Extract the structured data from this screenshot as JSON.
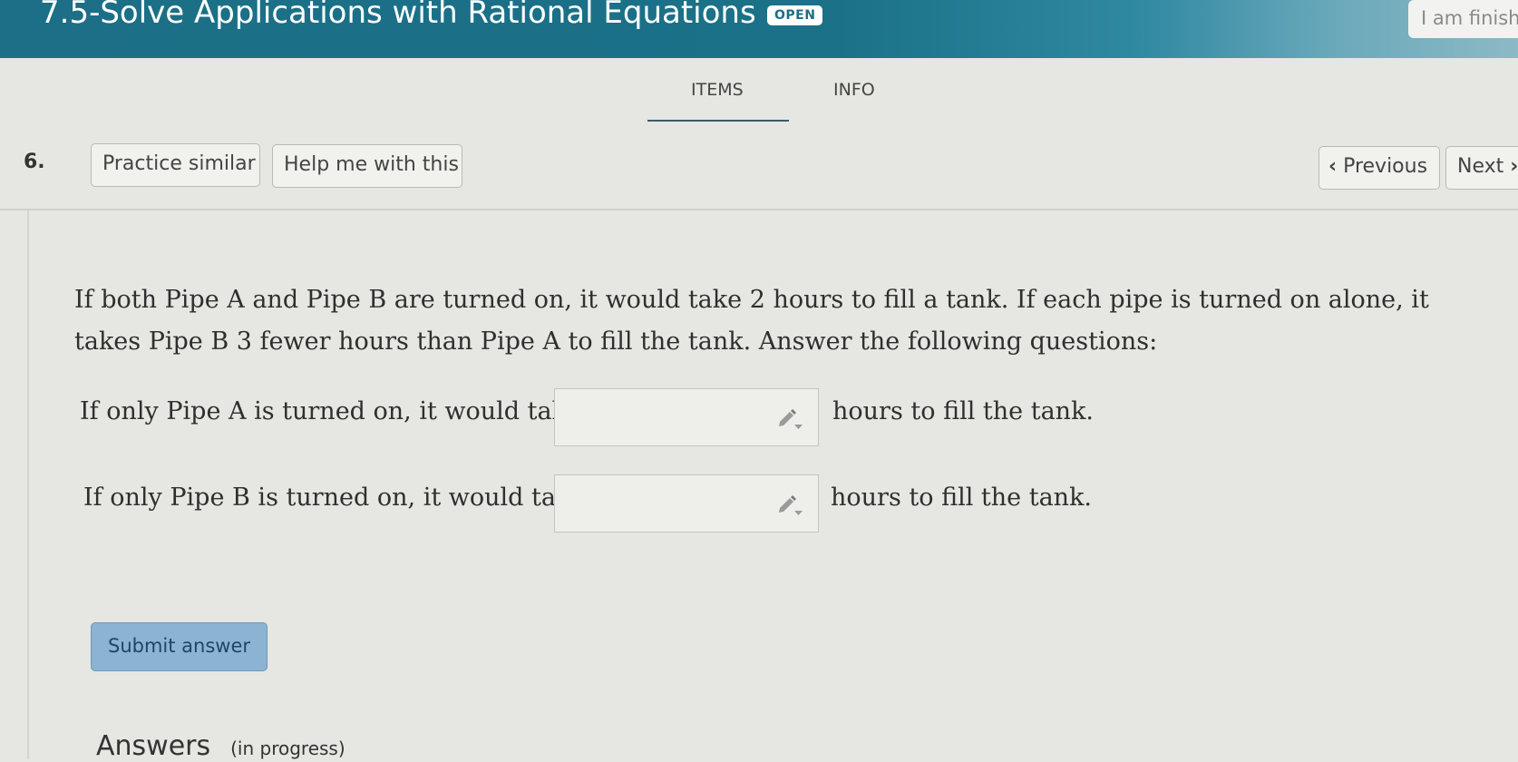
{
  "header": {
    "title": "7.5-Solve Applications with Rational Equations",
    "status_badge": "OPEN",
    "finish_button": "I am finish"
  },
  "tabs": [
    {
      "label": "ITEMS",
      "active": true
    },
    {
      "label": "INFO",
      "active": false
    }
  ],
  "toolbar": {
    "question_number": "6.",
    "practice_similar": "Practice similar",
    "help_me": "Help me with this",
    "previous": "Previous",
    "next": "Next"
  },
  "question": {
    "prompt": "If both Pipe A and Pipe B are turned on, it would take 2 hours to fill a tank. If each pipe is turned on alone, it takes Pipe B 3 fewer hours than Pipe A to fill the tank. Answer the following questions:",
    "rows": [
      {
        "before": "If only Pipe A is turned on, it would take",
        "value": "",
        "after": "hours to fill the tank."
      },
      {
        "before": "If only Pipe B is turned on, it would take",
        "value": "",
        "after": "hours to fill the tank."
      }
    ]
  },
  "submit_label": "Submit answer",
  "answers": {
    "heading": "Answers",
    "status": "(in progress)"
  },
  "colors": {
    "header_bg": "#1c6f86",
    "submit_bg": "#8cb3d1",
    "page_bg": "#e6e6e2"
  }
}
